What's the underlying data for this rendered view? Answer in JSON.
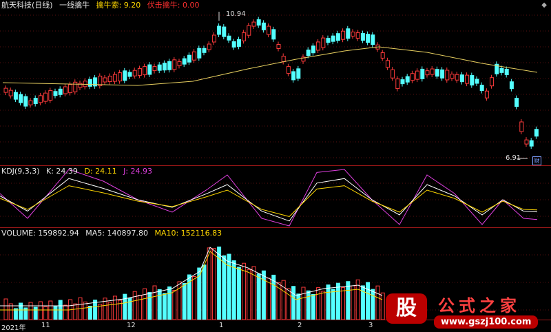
{
  "main_header": {
    "stock_name": "航天科技(日线)",
    "indicator_name": "一线擒牛",
    "qiniu_label": "擒牛索: 9.20",
    "fuji_label": "伏击擒牛: 0.00"
  },
  "kdj_header": {
    "name": "KDJ(9,3,3)",
    "k": "K: 24.39",
    "d": "D: 24.11",
    "j": "J: 24.93"
  },
  "vol_header": {
    "volume": "VOLUME: 159892.94",
    "ma5": "MA5: 140897.80",
    "ma10": "MA10: 152116.83"
  },
  "price_marks": {
    "high": "10.94",
    "low": "6.91"
  },
  "badge": "财",
  "menu_icon": "menu-icon",
  "date_axis": [
    "2021年",
    "11",
    "12",
    "1",
    "2",
    "3"
  ],
  "watermark": {
    "badge": "股",
    "title": "公式之家",
    "url": "www.gszj100.com"
  },
  "colors": {
    "up": "#ff3b3b",
    "down": "#54ffff",
    "ma": "#e8d060",
    "k": "#ffffff",
    "d": "#ffd700",
    "j": "#e040e0",
    "separator": "#a01818"
  }
}
